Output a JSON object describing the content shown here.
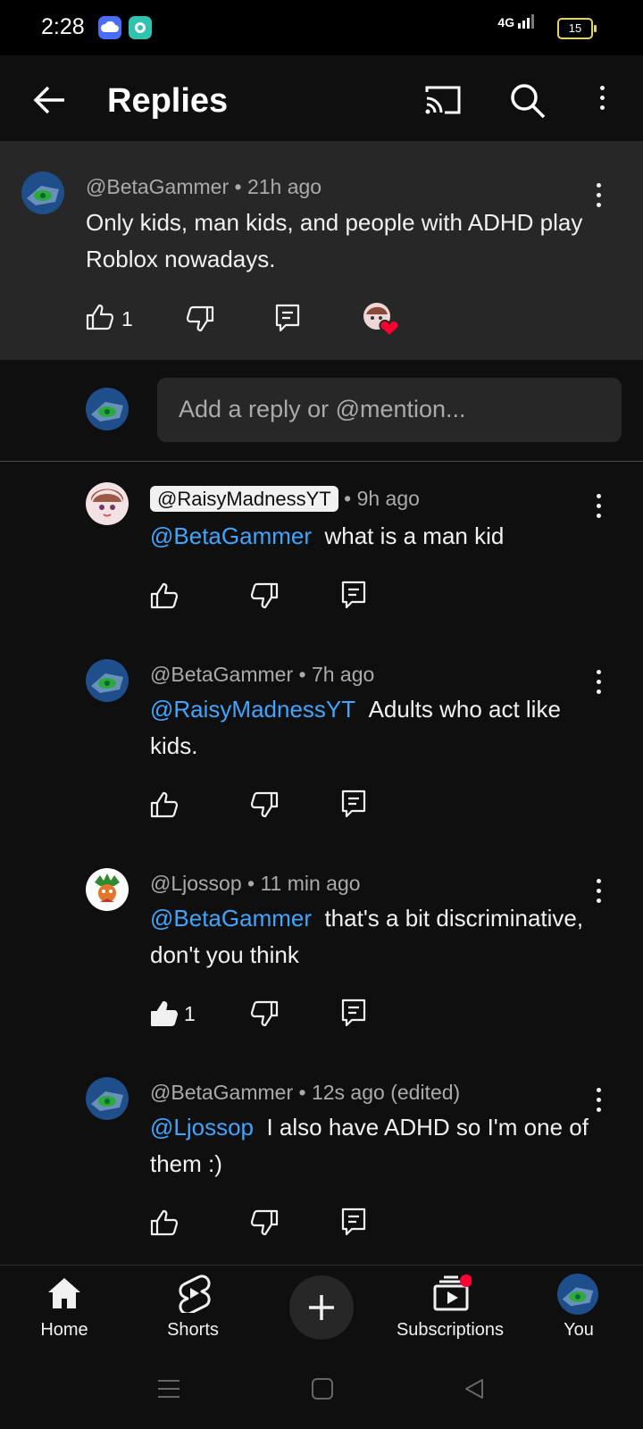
{
  "status": {
    "time": "2:28",
    "network": "4G",
    "battery": "15"
  },
  "header": {
    "title": "Replies"
  },
  "parent_comment": {
    "handle": "@BetaGammer",
    "meta": " • 21h ago",
    "text": "Only kids, man kids,  and people with ADHD play Roblox nowadays.",
    "likes": "1"
  },
  "reply_input": {
    "placeholder": "Add a reply or @mention..."
  },
  "replies": [
    {
      "handle": "@RaisyMadnessYT",
      "meta": " • 9h ago",
      "mention": "@BetaGammer",
      "text": "what is a man kid",
      "likes": ""
    },
    {
      "handle": "@BetaGammer",
      "meta": " • 7h ago",
      "mention": "@RaisyMadnessYT",
      "text": "Adults who act like kids.",
      "likes": ""
    },
    {
      "handle": "@Ljossop",
      "meta": " • 11 min ago",
      "mention": "@BetaGammer",
      "text": "that's a bit discriminative, don't you think",
      "likes": "1"
    },
    {
      "handle": "@BetaGammer",
      "meta": " • 12s ago (edited)",
      "mention": "@Ljossop",
      "text": "I also have ADHD so I'm one of them :)",
      "likes": ""
    }
  ],
  "nav": {
    "home": "Home",
    "shorts": "Shorts",
    "subscriptions": "Subscriptions",
    "you": "You"
  },
  "colors": {
    "background": "#0f0f0f",
    "surface": "#272727",
    "mention": "#3ea6ff",
    "heart": "#ff0033"
  }
}
